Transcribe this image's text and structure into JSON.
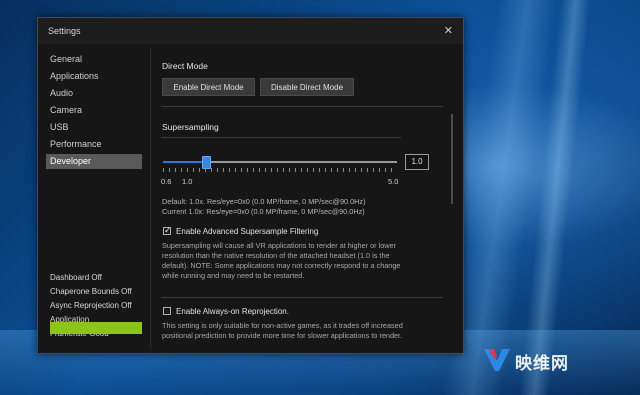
{
  "window": {
    "title": "Settings"
  },
  "sidebar": {
    "items": [
      {
        "label": "General"
      },
      {
        "label": "Applications"
      },
      {
        "label": "Audio"
      },
      {
        "label": "Camera"
      },
      {
        "label": "USB"
      },
      {
        "label": "Performance"
      },
      {
        "label": "Developer",
        "active": true
      }
    ],
    "status": [
      {
        "label": "Dashboard Off"
      },
      {
        "label": "Chaperone Bounds Off"
      },
      {
        "label": "Async Reprojection Off"
      },
      {
        "label": "Application"
      },
      {
        "label": "Framerate Good"
      }
    ],
    "status_color": "#8cc41a"
  },
  "direct_mode": {
    "title": "Direct Mode",
    "enable_label": "Enable Direct Mode",
    "disable_label": "Disable Direct Mode"
  },
  "supersampling": {
    "title": "Supersampling",
    "value": "1.0",
    "min_label": "0.6",
    "mid_label": "1.0",
    "max_label": "5.0",
    "slider_min": 0.6,
    "slider_max": 5.0,
    "slider_value": 1.0,
    "default_line": "Default: 1.0x. Res/eye=0x0 (0.0 MP/frame, 0 MP/sec@90.0Hz)",
    "current_line": "Current 1.0x: Res/eye=0x0 (0.0 MP/frame, 0 MP/sec@90.0Hz)",
    "filter_label": "Enable Advanced Supersample Filtering",
    "filter_checked": true,
    "desc_1": "Supersampling will cause all VR applications to render at higher or lower",
    "desc_2": "resolution than the native resolution of the attached headset (1.0 is the",
    "desc_3": "default). NOTE: Some applications may not correctly respond to a change",
    "desc_4": "while running and may need to be restarted."
  },
  "reprojection": {
    "label": "Enable Always-on Reprojection.",
    "checked": false,
    "desc_1": "This setting is only suitable for non-active games, as it trades off increased",
    "desc_2": "positional prediction to provide more time for slower applications to render."
  },
  "watermark": {
    "text": "映维网"
  },
  "colors": {
    "accent": "#2a79d8",
    "window_bg": "#161616"
  }
}
